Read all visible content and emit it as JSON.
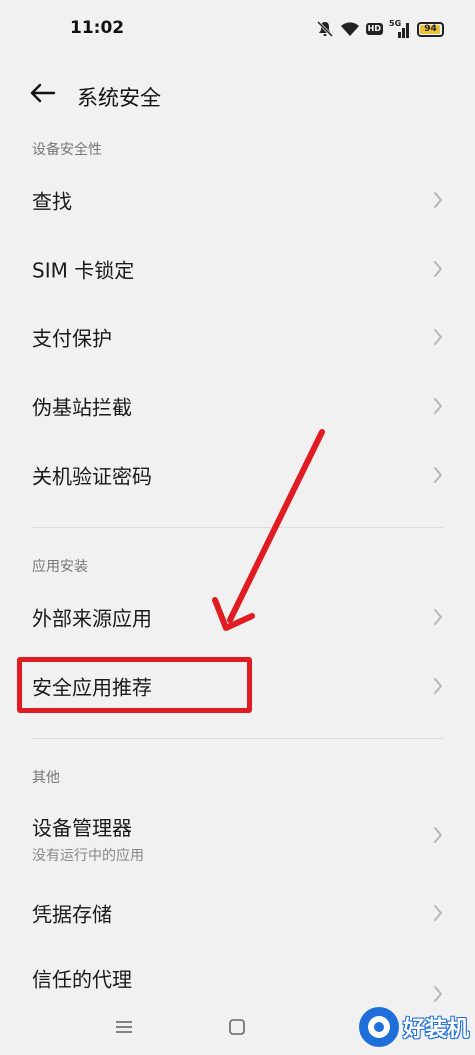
{
  "status_bar": {
    "time": "11:02",
    "network_label": "5G",
    "hd_label": "HD",
    "battery_level": "94",
    "battery_fraction": 0.94,
    "battery_color": "#e8c13b",
    "icons": [
      "mute-icon",
      "wifi-icon",
      "hd-icon",
      "signal-icon",
      "battery-icon"
    ]
  },
  "header": {
    "title": "系统安全",
    "back_icon": "arrow-left-icon"
  },
  "sections": [
    {
      "header": "设备安全性",
      "items": [
        {
          "label": "查找"
        },
        {
          "label": "SIM 卡锁定"
        },
        {
          "label": "支付保护"
        },
        {
          "label": "伪基站拦截"
        },
        {
          "label": "关机验证密码"
        }
      ]
    },
    {
      "header": "应用安装",
      "items": [
        {
          "label": "外部来源应用"
        },
        {
          "label": "安全应用推荐",
          "highlighted": true
        }
      ]
    },
    {
      "header": "其他",
      "items": [
        {
          "label": "设备管理器",
          "sublabel": "没有运行中的应用"
        },
        {
          "label": "凭据存储"
        },
        {
          "label": "信任的代理"
        }
      ]
    }
  ],
  "annotation": {
    "color": "#e01b22",
    "arrow_icon": "red-arrow-annotation"
  },
  "nav_bar": {
    "icons": [
      "menu-icon",
      "home-icon"
    ]
  },
  "watermark": {
    "text": "好装机",
    "color": "#1e6fd9"
  }
}
